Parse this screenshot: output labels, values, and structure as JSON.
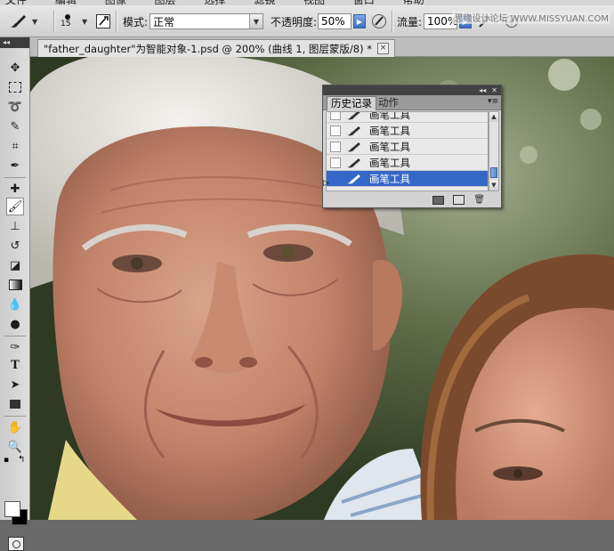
{
  "menubar": {
    "items": [
      "文件",
      "编辑",
      "图像",
      "图层",
      "选择",
      "滤镜",
      "视图",
      "窗口",
      "帮助"
    ]
  },
  "options": {
    "brush_size": "15",
    "mode_label": "模式:",
    "mode_value": "正常",
    "opacity_label": "不透明度:",
    "opacity_value": "50%",
    "flow_label": "流量:",
    "flow_value": "100%"
  },
  "watermark": "思缘设计论坛 WWW.MISSYUAN.COM",
  "document": {
    "tab_title": "\"father_daughter\"为智能对象-1.psd @ 200% (曲线 1, 图层蒙版/8) *",
    "close_glyph": "×"
  },
  "history_panel": {
    "tabs": [
      "历史记录",
      "动作"
    ],
    "items": [
      {
        "label": "画笔工具",
        "selected": false
      },
      {
        "label": "画笔工具",
        "selected": false
      },
      {
        "label": "画笔工具",
        "selected": false
      },
      {
        "label": "画笔工具",
        "selected": false
      },
      {
        "label": "画笔工具",
        "selected": true
      }
    ]
  },
  "colors": {
    "selection_blue": "#3468c8",
    "panel_gray": "#d3d3d3",
    "toolbox_gray": "#d4d4d4"
  },
  "icons": {
    "toolbox": [
      "move-icon",
      "marquee-icon",
      "lasso-icon",
      "quick-selection-icon",
      "crop-icon",
      "eyedropper-icon",
      "healing-brush-icon",
      "brush-icon",
      "clone-stamp-icon",
      "history-brush-icon",
      "eraser-icon",
      "gradient-icon",
      "blur-icon",
      "dodge-icon",
      "pen-icon",
      "type-icon",
      "path-selection-icon",
      "shape-icon",
      "hand-icon",
      "zoom-icon"
    ]
  }
}
